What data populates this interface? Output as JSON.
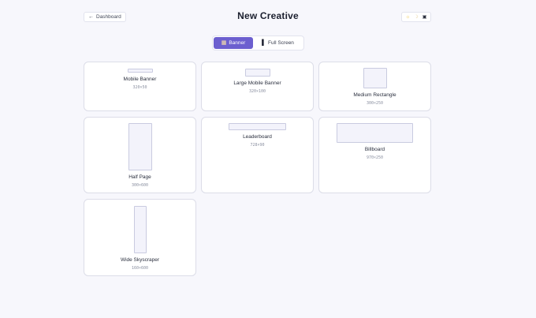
{
  "header": {
    "back_label": "Dashboard",
    "back_icon": "arrow-left-icon",
    "title": "New Creative",
    "theme_options": [
      {
        "name": "light",
        "glyph": "☼"
      },
      {
        "name": "dark",
        "glyph": "☽"
      },
      {
        "name": "system",
        "glyph": "▣"
      }
    ]
  },
  "tabs": [
    {
      "label": "Banner",
      "icon": "image-icon",
      "glyph": "▦",
      "active": true
    },
    {
      "label": "Full Screen",
      "icon": "phone-icon",
      "glyph": "▌",
      "active": false
    }
  ],
  "formats": [
    {
      "name": "Mobile Banner",
      "size": "320×50"
    },
    {
      "name": "Large Mobile Banner",
      "size": "320×100"
    },
    {
      "name": "Medium Rectangle",
      "size": "300×250"
    },
    {
      "name": "Half Page",
      "size": "300×600"
    },
    {
      "name": "Leaderboard",
      "size": "728×90"
    },
    {
      "name": "Billboard",
      "size": "970×250"
    },
    {
      "name": "Wide Skyscraper",
      "size": "160×600"
    }
  ]
}
